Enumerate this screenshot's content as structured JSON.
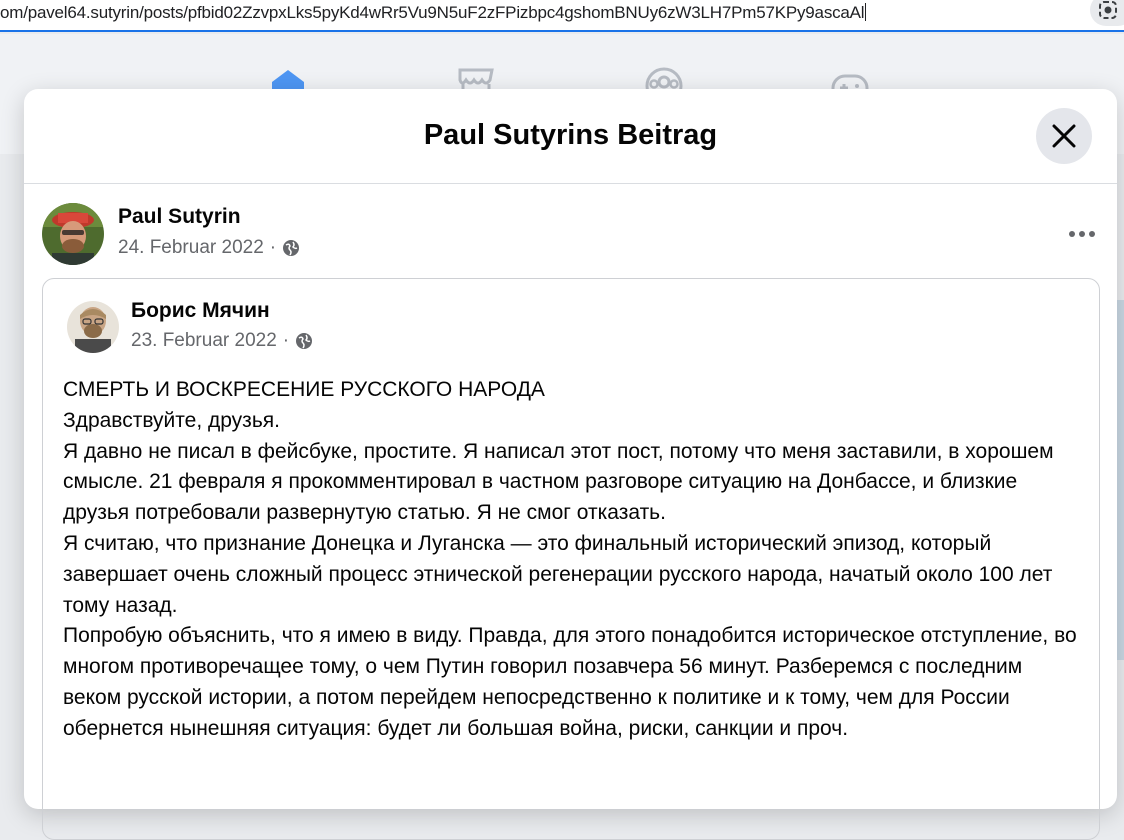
{
  "browser": {
    "url": "om/pavel64.sutyrin/posts/pfbid02ZzvpxLks5pyKd4wRr5Vu9N5uF2zFPizbpc4gshomBNUy6zW3LH7Pm57KPy9ascaAl"
  },
  "background_nav": {
    "icons": [
      "home-icon",
      "marketplace-icon",
      "groups-icon",
      "gaming-icon"
    ],
    "accent_color": "#1877f2"
  },
  "modal": {
    "title": "Paul Sutyrins Beitrag",
    "close_icon": "close-icon"
  },
  "post": {
    "author": "Paul Sutyrin",
    "date": "24. Februar 2022",
    "separator": "·",
    "privacy_icon": "globe-icon",
    "more_icon": "more-options-icon"
  },
  "shared_post": {
    "author": "Борис Мячин",
    "date": "23. Februar 2022",
    "separator": "·",
    "privacy_icon": "globe-icon",
    "paragraphs": [
      "СМЕРТЬ И ВОСКРЕСЕНИЕ РУССКОГО НАРОДА",
      "Здравствуйте, друзья.",
      "Я давно не писал в фейсбуке, простите. Я написал этот пост, потому что меня заставили, в хорошем смысле. 21 февраля я прокомментировал в частном разговоре ситуацию на Донбассе, и близкие друзья потребовали развернутую статью. Я не смог отказать.",
      "Я считаю, что признание Донецка и Луганска — это финальный исторический эпизод, который завершает очень сложный процесс этнической регенерации русского народа, начатый около 100 лет тому назад.",
      "Попробую объяснить, что я имею в виду. Правда, для этого понадобится историческое отступление, во многом противоречащее тому, о чем Путин говорил позавчера 56 минут. Разберемся с последним веком русской истории, а потом перейдем непосредственно к политике и к тому, чем для России обернется нынешняя ситуация: будет ли большая война, риски, санкции и проч."
    ]
  }
}
